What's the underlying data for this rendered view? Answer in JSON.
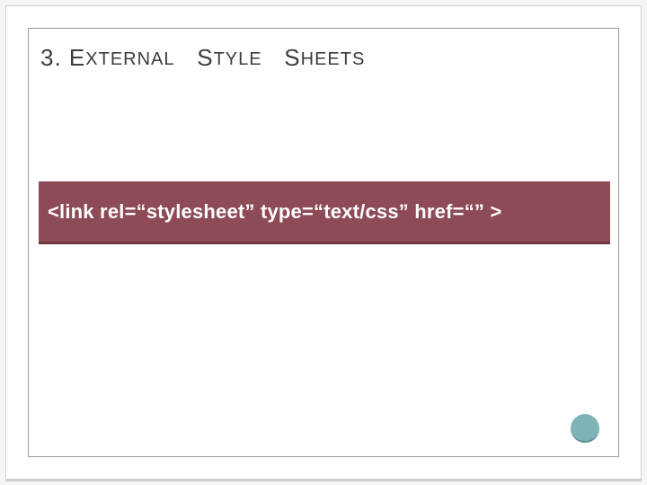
{
  "title": {
    "num": "3.",
    "w1_cap": "E",
    "w1_rest": "XTERNAL",
    "w2_cap": "S",
    "w2_rest": "TYLE",
    "w3_cap": "S",
    "w3_rest": "HEETS"
  },
  "code": "<link rel=“stylesheet” type=“text/css” href=“” >"
}
